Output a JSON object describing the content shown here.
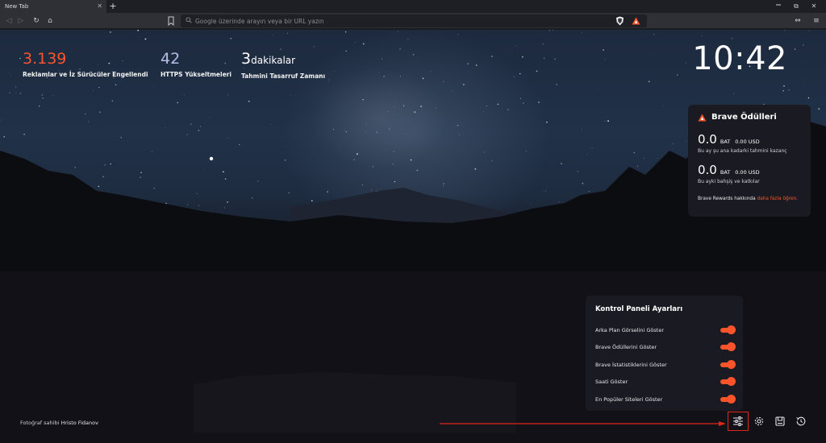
{
  "tab": {
    "title": "New Tab",
    "close": "✕",
    "new": "+"
  },
  "window": {
    "restore": "⧉",
    "close": "✕",
    "minimize": "—"
  },
  "toolbar": {
    "back": "◁",
    "forward": "▷",
    "reload": "↻",
    "home": "⌂",
    "menu": "≡",
    "rotate": "⇔"
  },
  "urlbar": {
    "placeholder": "Google üzerinde arayın veya bir URL yazın",
    "value": ""
  },
  "stats": {
    "trackers": {
      "value": "3.139",
      "label": "Reklamlar ve İz Sürücüler Engellendi",
      "color": "#fb542b"
    },
    "https": {
      "value": "42",
      "label": "HTTPS Yükseltmeleri"
    },
    "time": {
      "value": "3",
      "unit": "dakikalar",
      "label": "Tahmini Tasarruf Zamanı"
    }
  },
  "clock": "10:42",
  "rewards": {
    "title": "Brave Ödülleri",
    "month": {
      "amount": "0.0",
      "currency": "BAT",
      "usd": "0.00 USD",
      "desc": "Bu ay şu ana kadarki tahmini kazanç"
    },
    "tips": {
      "amount": "0.0",
      "currency": "BAT",
      "usd": "0.00 USD",
      "desc": "Bu ayki bahşiş ve katkılar"
    },
    "footer_prefix": "Brave Rewards hakkında ",
    "footer_link": "daha fazla öğren."
  },
  "settings_panel": {
    "title": "Kontrol Paneli Ayarları",
    "options": [
      {
        "label": "Arka Plan Görselini Göster",
        "on": true
      },
      {
        "label": "Brave Ödüllerini Göster",
        "on": true
      },
      {
        "label": "Brave İstatistiklerini Göster",
        "on": true
      },
      {
        "label": "Saati Göster",
        "on": true
      },
      {
        "label": "En Popüler Siteleri Göster",
        "on": true
      }
    ]
  },
  "credit": {
    "prefix": "Fotoğraf sahibi ",
    "author": "Hristo Fidanov"
  },
  "colors": {
    "accent": "#fb542b",
    "highlight": "#e0251b",
    "panel": "#1a1b22"
  },
  "icons": [
    "customize-icon",
    "gear-icon",
    "bookmarks-icon",
    "history-icon"
  ]
}
